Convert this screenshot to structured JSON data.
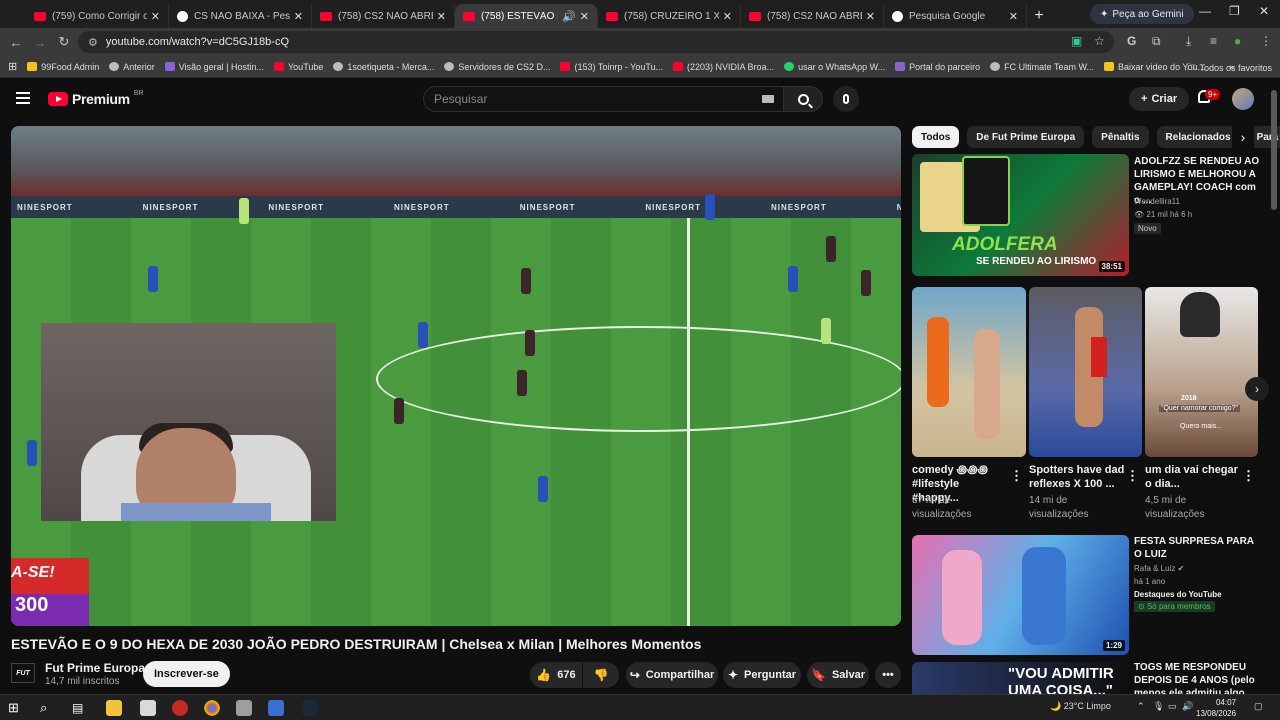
{
  "browser": {
    "tabs": [
      {
        "title": "(759) Como Corrigir o Erro",
        "icon": "youtube-icon"
      },
      {
        "title": "CS NÃO BAIXA - Pesquisa G",
        "icon": "google-icon"
      },
      {
        "title": "(758) CS2 NÃO ABRE? RESO",
        "icon": "youtube-icon"
      },
      {
        "title": "(758) ESTEVÃO E O 9 D",
        "icon": "youtube-icon",
        "active": true
      },
      {
        "title": "(758) CRUZEIRO 1 X 1 FLAM",
        "icon": "youtube-icon"
      },
      {
        "title": "(758) CS2 NÃO ABRE? RESO",
        "icon": "youtube-icon"
      },
      {
        "title": "Pesquisa Google",
        "icon": "google-icon"
      }
    ],
    "gemini_label": "Peça ao Gemini",
    "url": "youtube.com/watch?v=dC5GJ18b-cQ",
    "bookmarks": [
      {
        "label": "99Food Admin",
        "icon": "y"
      },
      {
        "label": "Anterior",
        "icon": "gr"
      },
      {
        "label": "Visão geral | Hostin...",
        "icon": "p"
      },
      {
        "label": "YouTube",
        "icon": "r"
      },
      {
        "label": "1soetiqueta - Merca...",
        "icon": "gr"
      },
      {
        "label": "Servidores de CS2 D...",
        "icon": "gr"
      },
      {
        "label": "(153) Toinrp - YouTu...",
        "icon": "r"
      },
      {
        "label": "(2203) NVIDIA Broa...",
        "icon": "r"
      },
      {
        "label": "usar o WhatsApp W...",
        "icon": "w"
      },
      {
        "label": "Portal do parceiro",
        "icon": "p"
      },
      {
        "label": "FC Ultimate Team W...",
        "icon": "gr"
      },
      {
        "label": "Baixar video do You...",
        "icon": "y"
      }
    ],
    "all_bookmarks": "Todos os favoritos"
  },
  "youtube": {
    "logo_text": "Premium",
    "logo_country": "BR",
    "search_placeholder": "Pesquisar",
    "create_label": "Criar",
    "notif_badge": "9+"
  },
  "video": {
    "title": "ESTEVÃO E O 9 DO HEXA DE 2030 JOÃO PEDRO DESTRUIRAM | Chelsea x Milan | Melhores Momentos",
    "adboard": "NINESPORT",
    "banner_line1": "A-SE!",
    "banner_line2": "300",
    "channel": {
      "logo": "FUT",
      "name": "Fut Prime Europa",
      "subs": "14,7 mil inscritos"
    },
    "subscribe_label": "Inscrever-se",
    "likes": "676",
    "share_label": "Compartilhar",
    "ask_label": "Perguntar",
    "save_label": "Salvar"
  },
  "sidebar": {
    "chips": [
      "Todos",
      "De Fut Prime Europa",
      "Pênaltis",
      "Relacionados",
      "Para"
    ],
    "videos": [
      {
        "title": "ADOLFZZ SE RENDEU AO LIRISMO E MELHOROU A GAMEPLAY! COACH com o ...",
        "channel": "Wendellira11",
        "meta": "21 mil  há 6 h",
        "badge": "Novo",
        "duration": "38:51",
        "thumb_text1": "ADOLFERA",
        "thumb_text2": "SE RENDEU AO LIRISMO"
      },
      {
        "title": "FESTA SURPRESA PARA O LUIZ",
        "channel": "Rafa & Luiz",
        "meta": "há 1 ano",
        "extra": "Destaques do YouTube",
        "badge": "Só para membros",
        "duration": "1:29"
      },
      {
        "title": "TOGS ME RESPONDEU DEPOIS DE 4 ANOS (pelo menos ele admitiu algo... M...",
        "thumb_text1": "\"VOU ADMITIR",
        "thumb_text2": "UMA COISA...\""
      }
    ],
    "shorts": [
      {
        "title": "comedy ꩜꩜꩜ #lifestyle #happy...",
        "views": "37 mi de visualizações"
      },
      {
        "title": "Spotters have dad reflexes X 100 ...",
        "views": "14 mi de visualizações"
      },
      {
        "title": "um dia vai chegar o dia...",
        "views": "4,5 mi de visualizações",
        "overlay1": "2018",
        "overlay2": "\"Quer namorar comigo?\"",
        "overlay3": "Quero mais..."
      }
    ]
  },
  "taskbar": {
    "weather": "23°C  Limpo",
    "time": "04:07",
    "date": "13/08/2026"
  }
}
